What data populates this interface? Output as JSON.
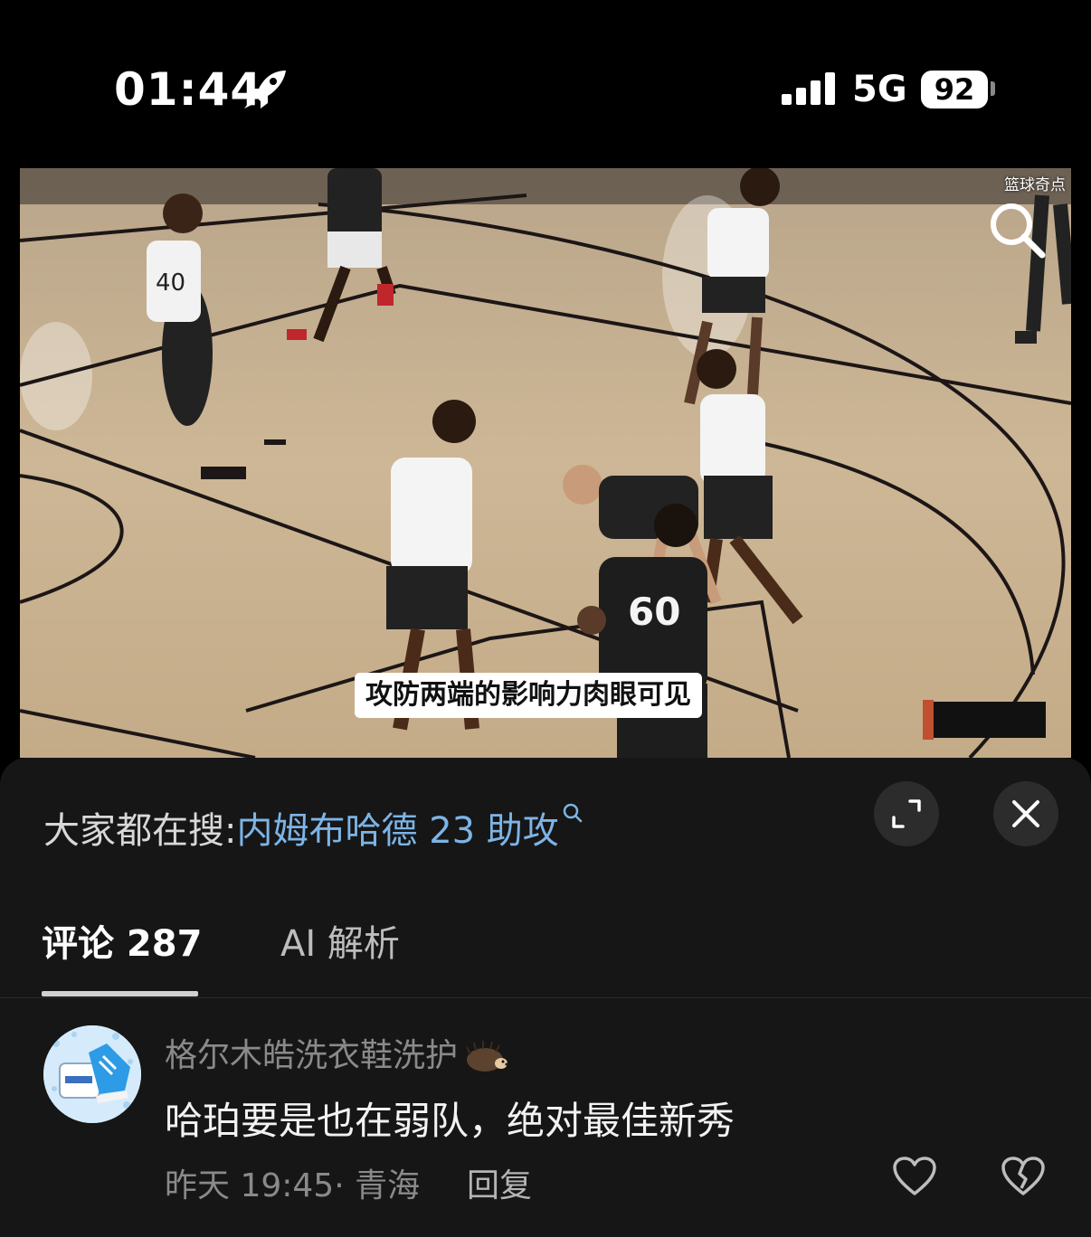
{
  "status_bar": {
    "time": "01:44",
    "network": "5G",
    "battery": "92"
  },
  "video": {
    "watermark": "篮球奇点",
    "subtitle": "攻防两端的影响力肉眼可见",
    "jersey_numbers": [
      "40",
      "60"
    ]
  },
  "search_suggestion": {
    "prefix": "大家都在搜:",
    "term": "内姆布哈德 23 助攻"
  },
  "tabs": [
    {
      "label": "评论 287",
      "active": true
    },
    {
      "label": "AI 解析",
      "active": false
    }
  ],
  "comments": [
    {
      "username": "格尔木皓洗衣鞋洗护",
      "text": "哈珀要是也在弱队，绝对最佳新秀",
      "meta": "昨天 19:45· 青海",
      "reply_label": "回复"
    }
  ],
  "colors": {
    "background": "#000000",
    "sheet": "#161616",
    "link": "#7db4e6",
    "muted_text": "#8a8a8a"
  }
}
